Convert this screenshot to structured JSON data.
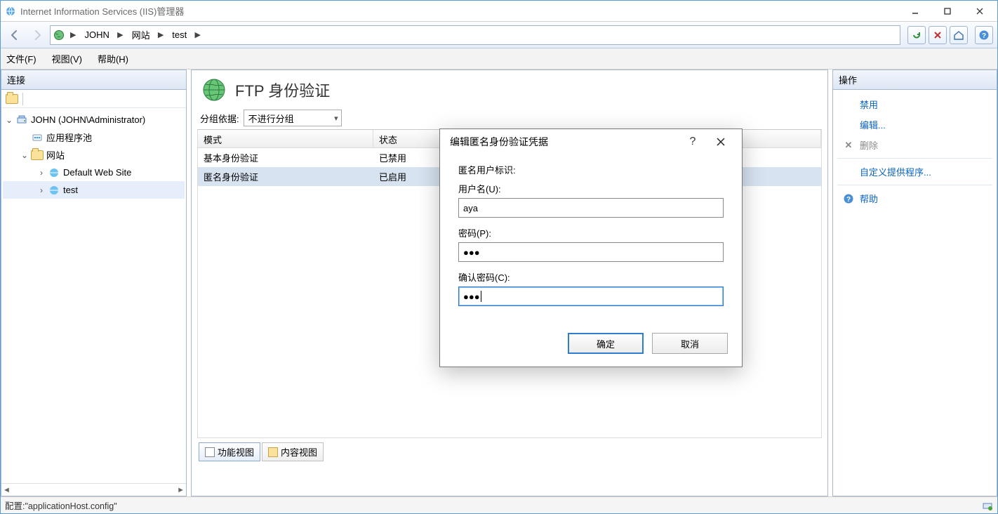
{
  "window": {
    "title": "Internet Information Services (IIS)管理器"
  },
  "breadcrumb": {
    "parts": [
      "JOHN",
      "网站",
      "test"
    ]
  },
  "menubar": {
    "file": "文件(F)",
    "view": "视图(V)",
    "help": "帮助(H)"
  },
  "connections": {
    "header": "连接",
    "root": {
      "label": "JOHN (JOHN\\Administrator)"
    },
    "appPools": "应用程序池",
    "sites": "网站",
    "site1": "Default Web Site",
    "site2": "test"
  },
  "center": {
    "title": "FTP 身份验证",
    "group_label": "分组依据:",
    "group_value": "不进行分组",
    "col_mode": "模式",
    "col_status": "状态",
    "rows": [
      {
        "mode": "基本身份验证",
        "status": "已禁用"
      },
      {
        "mode": "匿名身份验证",
        "status": "已启用"
      }
    ],
    "tab_feature": "功能视图",
    "tab_content": "内容视图"
  },
  "actions": {
    "header": "操作",
    "disable": "禁用",
    "edit": "编辑...",
    "delete": "删除",
    "customProviders": "自定义提供程序...",
    "help": "帮助"
  },
  "dialog": {
    "title": "编辑匿名身份验证凭据",
    "section": "匿名用户标识:",
    "username_label": "用户名(U):",
    "username_value": "aya",
    "password_label": "密码(P):",
    "password_value": "●●●",
    "confirm_label": "确认密码(C):",
    "confirm_value": "●●●",
    "ok": "确定",
    "cancel": "取消"
  },
  "statusbar": {
    "text": "配置:\"applicationHost.config\""
  }
}
